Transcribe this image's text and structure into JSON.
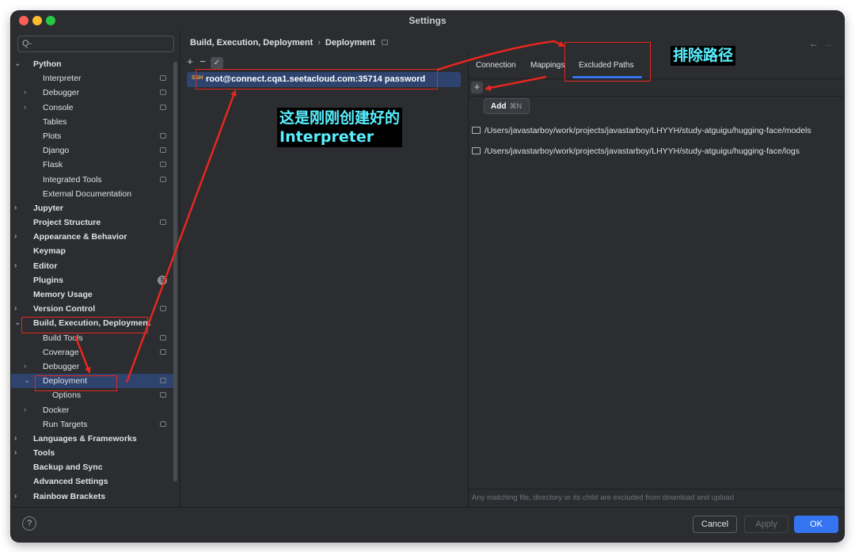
{
  "window": {
    "title": "Settings"
  },
  "sidebar": {
    "search_placeholder": "Q-",
    "items": [
      {
        "label": "Python",
        "bold": true,
        "chevron": "down",
        "level": 0
      },
      {
        "label": "Interpreter",
        "bold": false,
        "chevron": "",
        "level": 1,
        "stored": true
      },
      {
        "label": "Debugger",
        "bold": false,
        "chevron": "right",
        "level": 1,
        "stored": true
      },
      {
        "label": "Console",
        "bold": false,
        "chevron": "right",
        "level": 1,
        "stored": true
      },
      {
        "label": "Tables",
        "bold": false,
        "chevron": "",
        "level": 1
      },
      {
        "label": "Plots",
        "bold": false,
        "chevron": "",
        "level": 1,
        "stored": true
      },
      {
        "label": "Django",
        "bold": false,
        "chevron": "",
        "level": 1,
        "stored": true
      },
      {
        "label": "Flask",
        "bold": false,
        "chevron": "",
        "level": 1,
        "stored": true
      },
      {
        "label": "Integrated Tools",
        "bold": false,
        "chevron": "",
        "level": 1,
        "stored": true
      },
      {
        "label": "External Documentation",
        "bold": false,
        "chevron": "",
        "level": 1
      },
      {
        "label": "Jupyter",
        "bold": true,
        "chevron": "right",
        "level": 0
      },
      {
        "label": "Project Structure",
        "bold": true,
        "chevron": "",
        "level": 0,
        "stored": true
      },
      {
        "label": "Appearance & Behavior",
        "bold": true,
        "chevron": "right",
        "level": 0
      },
      {
        "label": "Keymap",
        "bold": true,
        "chevron": "",
        "level": 0
      },
      {
        "label": "Editor",
        "bold": true,
        "chevron": "right",
        "level": 0
      },
      {
        "label": "Plugins",
        "bold": true,
        "chevron": "",
        "level": 0,
        "badge": "5"
      },
      {
        "label": "Memory Usage",
        "bold": true,
        "chevron": "",
        "level": 0
      },
      {
        "label": "Version Control",
        "bold": true,
        "chevron": "right",
        "level": 0,
        "stored": true
      },
      {
        "label": "Build, Execution, Deployment",
        "bold": true,
        "chevron": "down",
        "level": 0
      },
      {
        "label": "Build Tools",
        "bold": false,
        "chevron": "",
        "level": 1,
        "stored": true
      },
      {
        "label": "Coverage",
        "bold": false,
        "chevron": "",
        "level": 1,
        "stored": true
      },
      {
        "label": "Debugger",
        "bold": false,
        "chevron": "right",
        "level": 1
      },
      {
        "label": "Deployment",
        "bold": false,
        "chevron": "down",
        "level": 1,
        "stored": true,
        "selected": true
      },
      {
        "label": "Options",
        "bold": false,
        "chevron": "",
        "level": 2,
        "stored": true
      },
      {
        "label": "Docker",
        "bold": false,
        "chevron": "right",
        "level": 1
      },
      {
        "label": "Run Targets",
        "bold": false,
        "chevron": "",
        "level": 1,
        "stored": true
      },
      {
        "label": "Languages & Frameworks",
        "bold": true,
        "chevron": "right",
        "level": 0
      },
      {
        "label": "Tools",
        "bold": true,
        "chevron": "right",
        "level": 0
      },
      {
        "label": "Backup and Sync",
        "bold": true,
        "chevron": "",
        "level": 0
      },
      {
        "label": "Advanced Settings",
        "bold": true,
        "chevron": "",
        "level": 0
      },
      {
        "label": "Rainbow Brackets",
        "bold": true,
        "chevron": "right",
        "level": 0
      }
    ]
  },
  "breadcrumb": {
    "parent": "Build, Execution, Deployment",
    "separator": "›",
    "current": "Deployment"
  },
  "nav": {
    "back": "←",
    "forward": "→"
  },
  "servers": {
    "toolbar": {
      "add": "+",
      "remove": "−",
      "set_default": "✓"
    },
    "items": [
      {
        "type": "SSH",
        "name": "root@connect.cqa1.seetacloud.com:35714 password"
      }
    ]
  },
  "tabs": [
    {
      "label": "Connection",
      "active": false
    },
    {
      "label": "Mappings",
      "active": false
    },
    {
      "label": "Excluded Paths",
      "active": true
    }
  ],
  "excluded": {
    "add_button": "+",
    "tooltip": {
      "label": "Add",
      "shortcut": "⌘N"
    },
    "paths": [
      "/Users/javastarboy/work/projects/javastarboy/LHYYH/study-atguigu/hugging-face/models",
      "/Users/javastarboy/work/projects/javastarboy/LHYYH/study-atguigu/hugging-face/logs"
    ],
    "note": "Any matching file, directory or its child are excluded from download and upload"
  },
  "footer": {
    "help": "?",
    "cancel": "Cancel",
    "apply": "Apply",
    "ok": "OK"
  },
  "annotations": {
    "excluded_paths_label": "排除路径",
    "interpreter_label_line1": "这是刚刚创建好的",
    "interpreter_label_line2": "Interpreter",
    "color": "#e6271f",
    "label_text_color": "#59f0ff"
  }
}
